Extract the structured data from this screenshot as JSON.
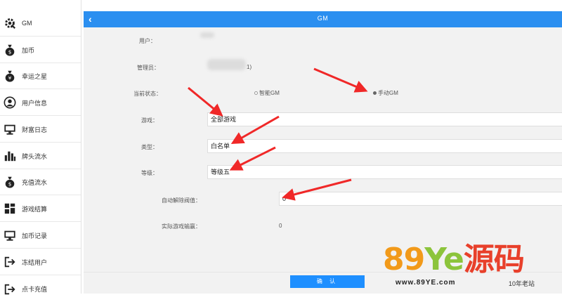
{
  "sidebar": {
    "items": [
      {
        "label": "GM",
        "icon": "gear-icon"
      },
      {
        "label": "加币",
        "icon": "money-bag-icon"
      },
      {
        "label": "幸运之星",
        "icon": "money-bag-icon"
      },
      {
        "label": "用户信息",
        "icon": "user-icon"
      },
      {
        "label": "财富日志",
        "icon": "monitor-icon"
      },
      {
        "label": "牌头流水",
        "icon": "bar-chart-icon"
      },
      {
        "label": "充值流水",
        "icon": "money-bag-icon"
      },
      {
        "label": "游戏结算",
        "icon": "grid-icon"
      },
      {
        "label": "加币记录",
        "icon": "monitor-icon"
      },
      {
        "label": "冻结用户",
        "icon": "logout-icon"
      },
      {
        "label": "点卡充值",
        "icon": "logout-icon"
      }
    ]
  },
  "header": {
    "back_symbol": "‹",
    "title": "GM",
    "background_color": "#2b8ff0"
  },
  "form": {
    "user_label": "用户：",
    "admin_label": "管理员：",
    "admin_value_suffix": "1)",
    "status_label": "当前状态：",
    "status_options": [
      {
        "label": "智能GM",
        "checked": false
      },
      {
        "label": "手动GM",
        "checked": true
      }
    ],
    "game_label": "游戏：",
    "game_value": "全部游戏",
    "type_label": "类型：",
    "type_value": "白名单",
    "level_label": "等级：",
    "level_value": "等级五",
    "auto_threshold_label": "自动解除阀值：",
    "auto_threshold_value": "0",
    "actual_loss_label": "实际游戏输赢：",
    "actual_loss_value": "0",
    "confirm_label": "确 认",
    "accent_color": "#1e8fff"
  },
  "annotations": {
    "arrow_color": "#f02828"
  },
  "watermark": {
    "brand_digits": "89",
    "brand_ye": "Ye",
    "brand_cn": "源码",
    "url": "www.89YE.com",
    "tag": "10年老站"
  }
}
